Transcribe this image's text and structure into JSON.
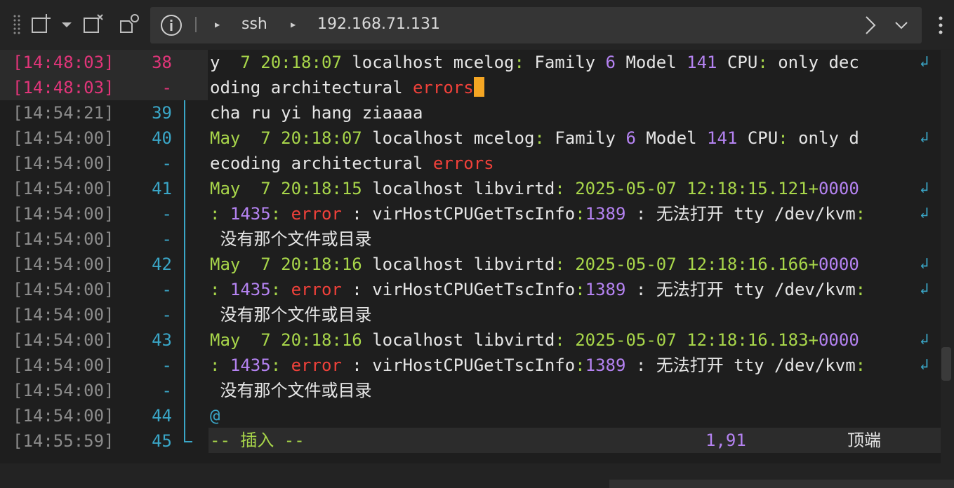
{
  "toolbar": {
    "breadcrumb": [
      "ssh",
      "192.168.71.131"
    ]
  },
  "terminal": {
    "rows": [
      {
        "ts": "[14:48:03]",
        "ln": "38",
        "hl": true,
        "wrap": true,
        "segs": [
          {
            "t": "y  ",
            "c": "w"
          },
          {
            "t": "7 20:18:07",
            "c": "g"
          },
          {
            "t": " localhost mcelog",
            "c": "w"
          },
          {
            "t": ":",
            "c": "g"
          },
          {
            "t": " Family ",
            "c": "w"
          },
          {
            "t": "6",
            "c": "p"
          },
          {
            "t": " Model ",
            "c": "w"
          },
          {
            "t": "141",
            "c": "p"
          },
          {
            "t": " CPU",
            "c": "w"
          },
          {
            "t": ":",
            "c": "g"
          },
          {
            "t": " only dec",
            "c": "w"
          }
        ]
      },
      {
        "ts": "[14:48:03]",
        "ln": "-",
        "hl": true,
        "cursor": true,
        "segs": [
          {
            "t": "oding architectural ",
            "c": "w"
          },
          {
            "t": "errors",
            "c": "r"
          }
        ]
      },
      {
        "ts": "[14:54:21]",
        "ln": "39",
        "segs": [
          {
            "t": "cha ru yi hang ziaaaa",
            "c": "w"
          }
        ]
      },
      {
        "ts": "[14:54:00]",
        "ln": "40",
        "wrap": true,
        "segs": [
          {
            "t": "May  ",
            "c": "g"
          },
          {
            "t": "7 20:18:07",
            "c": "g"
          },
          {
            "t": " localhost mcelog",
            "c": "w"
          },
          {
            "t": ":",
            "c": "g"
          },
          {
            "t": " Family ",
            "c": "w"
          },
          {
            "t": "6",
            "c": "p"
          },
          {
            "t": " Model ",
            "c": "w"
          },
          {
            "t": "141",
            "c": "p"
          },
          {
            "t": " CPU",
            "c": "w"
          },
          {
            "t": ":",
            "c": "g"
          },
          {
            "t": " only d",
            "c": "w"
          }
        ]
      },
      {
        "ts": "[14:54:00]",
        "ln": "-",
        "segs": [
          {
            "t": "ecoding architectural ",
            "c": "w"
          },
          {
            "t": "errors",
            "c": "r"
          }
        ]
      },
      {
        "ts": "[14:54:00]",
        "ln": "41",
        "wrap": true,
        "segs": [
          {
            "t": "May  ",
            "c": "g"
          },
          {
            "t": "7 20:18:15",
            "c": "g"
          },
          {
            "t": " localhost libvirtd",
            "c": "w"
          },
          {
            "t": ": 2025-05-07 12:18:15.121+",
            "c": "g"
          },
          {
            "t": "0000",
            "c": "p"
          }
        ]
      },
      {
        "ts": "[14:54:00]",
        "ln": "-",
        "wrap": true,
        "segs": [
          {
            "t": ": ",
            "c": "g"
          },
          {
            "t": "1435",
            "c": "p"
          },
          {
            "t": ": ",
            "c": "g"
          },
          {
            "t": "error",
            "c": "r"
          },
          {
            "t": " : virHostCPUGetTscInfo",
            "c": "w"
          },
          {
            "t": ":",
            "c": "g"
          },
          {
            "t": "1389",
            "c": "p"
          },
          {
            "t": " : ",
            "c": "w"
          },
          {
            "t": "无法打开",
            "c": "w",
            "cjk": true
          },
          {
            "t": " tty /dev/kvm",
            "c": "w"
          },
          {
            "t": ":",
            "c": "g"
          }
        ]
      },
      {
        "ts": "[14:54:00]",
        "ln": "-",
        "segs": [
          {
            "t": " ",
            "c": "w"
          },
          {
            "t": "没有那个文件或目录",
            "c": "w",
            "cjk": true
          }
        ]
      },
      {
        "ts": "[14:54:00]",
        "ln": "42",
        "wrap": true,
        "segs": [
          {
            "t": "May  ",
            "c": "g"
          },
          {
            "t": "7 20:18:16",
            "c": "g"
          },
          {
            "t": " localhost libvirtd",
            "c": "w"
          },
          {
            "t": ": 2025-05-07 12:18:16.166+",
            "c": "g"
          },
          {
            "t": "0000",
            "c": "p"
          }
        ]
      },
      {
        "ts": "[14:54:00]",
        "ln": "-",
        "wrap": true,
        "segs": [
          {
            "t": ": ",
            "c": "g"
          },
          {
            "t": "1435",
            "c": "p"
          },
          {
            "t": ": ",
            "c": "g"
          },
          {
            "t": "error",
            "c": "r"
          },
          {
            "t": " : virHostCPUGetTscInfo",
            "c": "w"
          },
          {
            "t": ":",
            "c": "g"
          },
          {
            "t": "1389",
            "c": "p"
          },
          {
            "t": " : ",
            "c": "w"
          },
          {
            "t": "无法打开",
            "c": "w",
            "cjk": true
          },
          {
            "t": " tty /dev/kvm",
            "c": "w"
          },
          {
            "t": ":",
            "c": "g"
          }
        ]
      },
      {
        "ts": "[14:54:00]",
        "ln": "-",
        "segs": [
          {
            "t": " ",
            "c": "w"
          },
          {
            "t": "没有那个文件或目录",
            "c": "w",
            "cjk": true
          }
        ]
      },
      {
        "ts": "[14:54:00]",
        "ln": "43",
        "wrap": true,
        "segs": [
          {
            "t": "May  ",
            "c": "g"
          },
          {
            "t": "7 20:18:16",
            "c": "g"
          },
          {
            "t": " localhost libvirtd",
            "c": "w"
          },
          {
            "t": ": 2025-05-07 12:18:16.183+",
            "c": "g"
          },
          {
            "t": "0000",
            "c": "p"
          }
        ]
      },
      {
        "ts": "[14:54:00]",
        "ln": "-",
        "wrap": true,
        "segs": [
          {
            "t": ": ",
            "c": "g"
          },
          {
            "t": "1435",
            "c": "p"
          },
          {
            "t": ": ",
            "c": "g"
          },
          {
            "t": "error",
            "c": "r"
          },
          {
            "t": " : virHostCPUGetTscInfo",
            "c": "w"
          },
          {
            "t": ":",
            "c": "g"
          },
          {
            "t": "1389",
            "c": "p"
          },
          {
            "t": " : ",
            "c": "w"
          },
          {
            "t": "无法打开",
            "c": "w",
            "cjk": true
          },
          {
            "t": " tty /dev/kvm",
            "c": "w"
          },
          {
            "t": ":",
            "c": "g"
          }
        ]
      },
      {
        "ts": "[14:54:00]",
        "ln": "-",
        "segs": [
          {
            "t": " ",
            "c": "w"
          },
          {
            "t": "没有那个文件或目录",
            "c": "w",
            "cjk": true
          }
        ]
      },
      {
        "ts": "[14:54:00]",
        "ln": "44",
        "segs": [
          {
            "t": "@",
            "c": "cy"
          }
        ]
      },
      {
        "ts": "[14:55:59]",
        "ln": "45",
        "segs": []
      }
    ],
    "status": {
      "mode_prefix": "-- ",
      "mode": "插入",
      "mode_suffix": " --",
      "position": "1,91",
      "scroll": "顶端"
    }
  },
  "colors": {
    "green": "#a8d64a",
    "purple": "#b583f2",
    "red": "#f0413a",
    "cyan": "#3aa6c7",
    "pink": "#e2357a",
    "cursor": "#f5a623"
  }
}
